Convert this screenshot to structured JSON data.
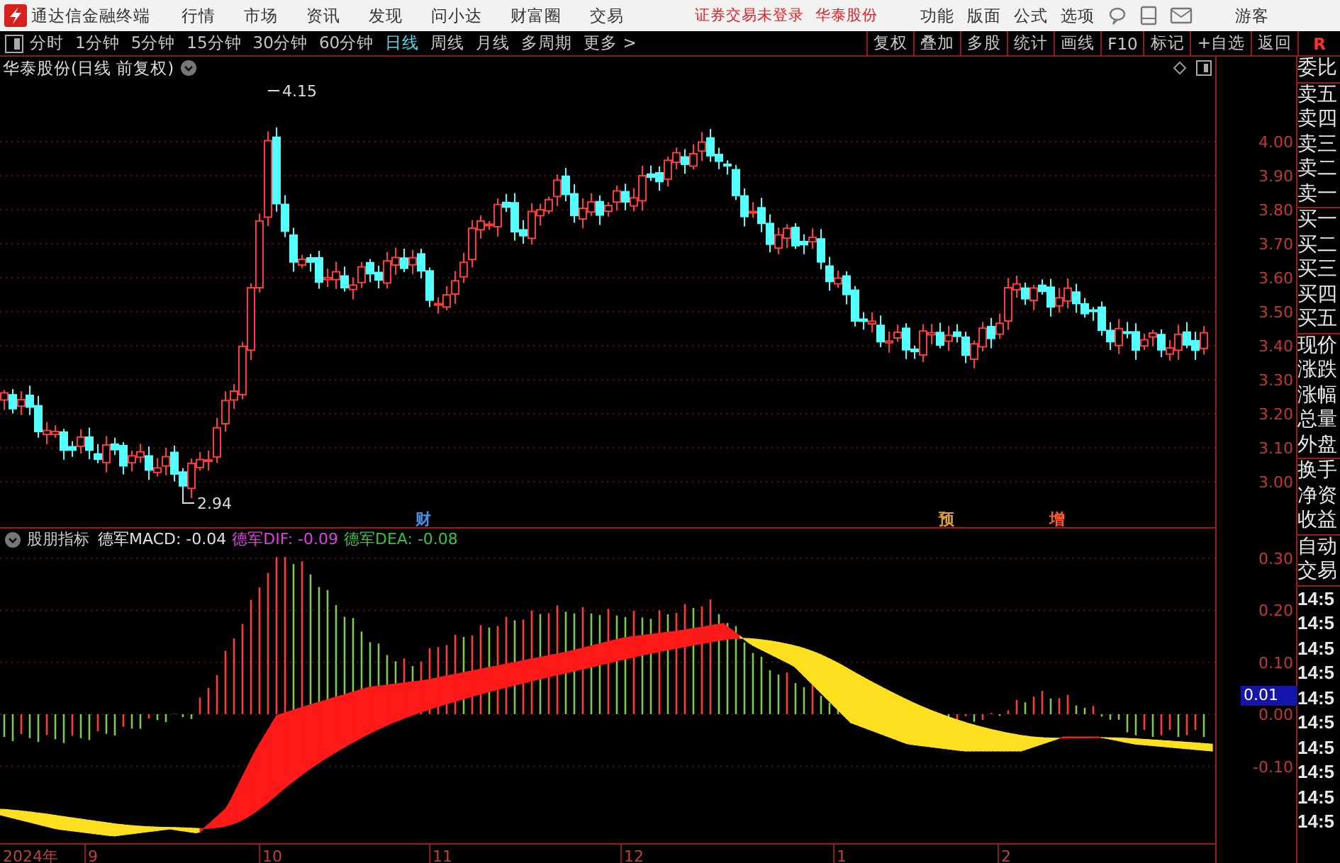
{
  "app_bar": {
    "app_name": "通达信金融终端",
    "menu": [
      "行情",
      "市场",
      "资讯",
      "发现",
      "问小达",
      "财富圈",
      "交易"
    ],
    "login_status": "证券交易未登录",
    "stock_name": "华泰股份",
    "tools": [
      "功能",
      "版面",
      "公式",
      "选项"
    ],
    "user": "游客"
  },
  "toolbar": {
    "periods": [
      {
        "label": "分时",
        "selected": false
      },
      {
        "label": "1分钟",
        "selected": false
      },
      {
        "label": "5分钟",
        "selected": false
      },
      {
        "label": "15分钟",
        "selected": false
      },
      {
        "label": "30分钟",
        "selected": false
      },
      {
        "label": "60分钟",
        "selected": false
      },
      {
        "label": "日线",
        "selected": true
      },
      {
        "label": "周线",
        "selected": false
      },
      {
        "label": "月线",
        "selected": false
      },
      {
        "label": "多周期",
        "selected": false
      }
    ],
    "more": "更多 >",
    "actions": [
      "复权",
      "叠加",
      "多股",
      "统计",
      "画线",
      "F10",
      "标记",
      "+自选",
      "返回"
    ],
    "panel_tab": "R"
  },
  "price_chart": {
    "title": "华泰股份(日线 前复权)",
    "y_ticks": [
      "4.00",
      "3.90",
      "3.80",
      "3.70",
      "3.60",
      "3.50",
      "3.40",
      "3.30",
      "3.20",
      "3.10",
      "3.00"
    ],
    "high_label": "4.15",
    "low_label": "2.94",
    "events": [
      {
        "label": "财",
        "color": "#4a90e0"
      },
      {
        "label": "预",
        "color": "#e0a030"
      },
      {
        "label": "增",
        "color": "#ff5a30"
      }
    ]
  },
  "indicator": {
    "name": "股朋指标",
    "values": [
      {
        "label": "德军MACD: -0.04",
        "color": "#e0e0e0"
      },
      {
        "label": "德军DIF: -0.09",
        "color": "#e040e0"
      },
      {
        "label": "德军DEA: -0.08",
        "color": "#40c040"
      }
    ],
    "y_ticks": [
      "0.30",
      "0.20",
      "0.10",
      "0.00",
      "-0.10"
    ],
    "cursor_value": "0.01"
  },
  "time_axis": [
    "2024年",
    "9",
    "10",
    "11",
    "12",
    "1",
    "2"
  ],
  "quote_panel": {
    "groups": [
      [
        "委比"
      ],
      [
        "卖五",
        "卖四",
        "卖三",
        "卖二",
        "卖一"
      ],
      [
        "买一",
        "买二",
        "买三",
        "买四",
        "买五"
      ],
      [
        "现价",
        "涨跌",
        "涨幅",
        "总量",
        "外盘"
      ],
      [
        "换手",
        "净资",
        "收益"
      ],
      [
        "自动",
        "交易"
      ]
    ],
    "times": [
      "14:5",
      "14:5",
      "14:5",
      "14:5",
      "14:5",
      "14:5",
      "14:5",
      "14:5",
      "14:5",
      "14:5"
    ]
  }
}
